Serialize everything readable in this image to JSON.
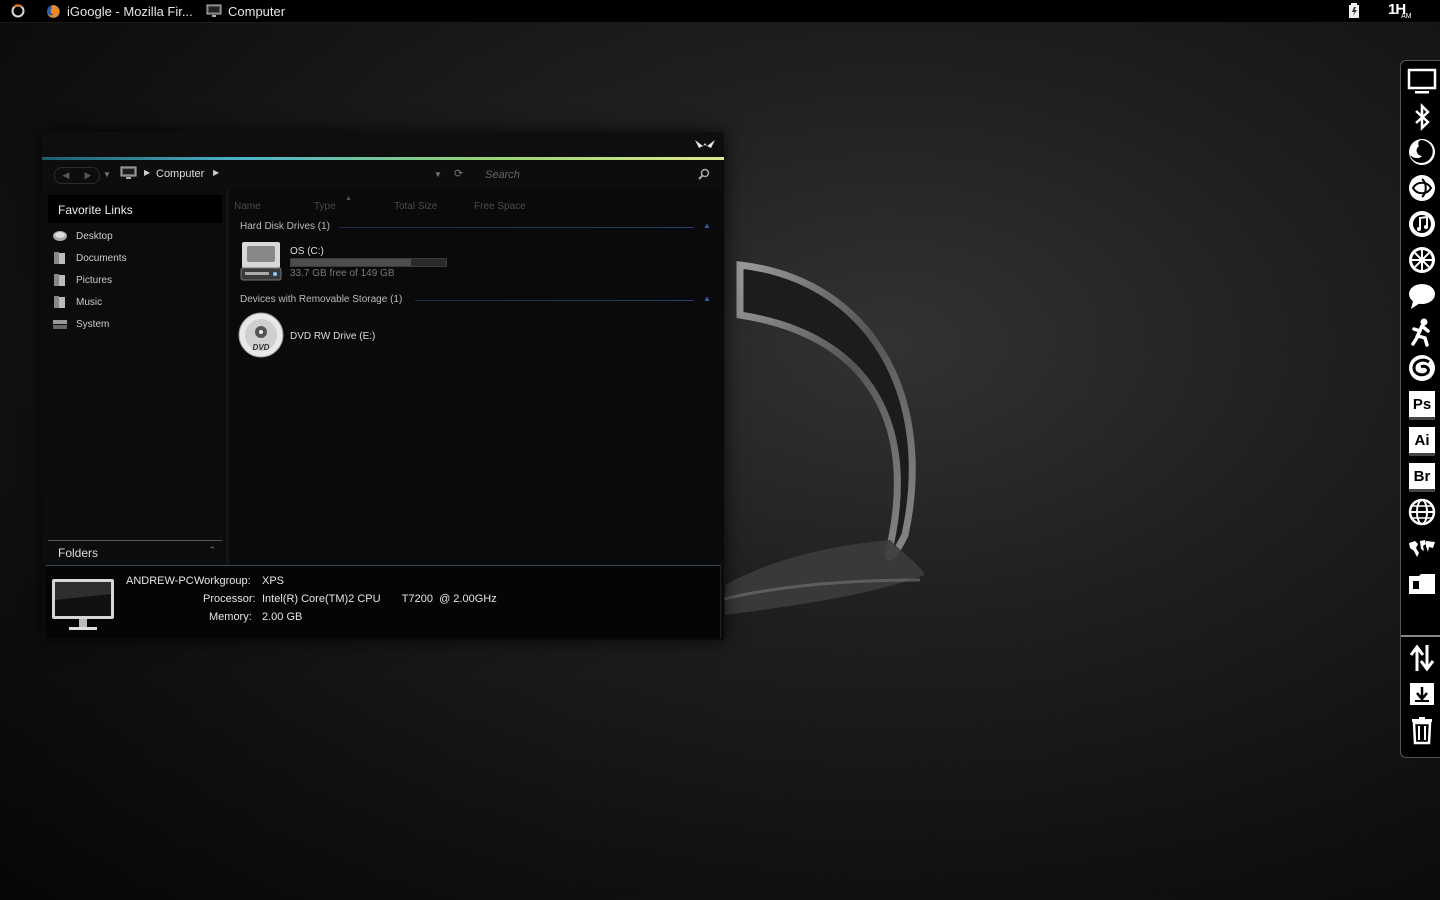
{
  "taskbar": {
    "tasks": [
      {
        "label": "iGoogle - Mozilla Fir...",
        "icon": "firefox-icon"
      },
      {
        "label": "Computer",
        "icon": "computer-icon"
      }
    ],
    "clock": {
      "hour": "1",
      "suffix": "AM",
      "glyph": "H"
    }
  },
  "window": {
    "breadcrumb": "Computer",
    "search_placeholder": "Search",
    "favorites_title": "Favorite Links",
    "favorites": [
      {
        "label": "Desktop",
        "icon": "desktop-icon"
      },
      {
        "label": "Documents",
        "icon": "documents-icon"
      },
      {
        "label": "Pictures",
        "icon": "pictures-icon"
      },
      {
        "label": "Music",
        "icon": "music-icon"
      },
      {
        "label": "System",
        "icon": "system-icon"
      }
    ],
    "folders_label": "Folders",
    "columns": [
      "Name",
      "Type",
      "Total Size",
      "Free Space"
    ],
    "groups": [
      {
        "title": "Hard Disk Drives (1)",
        "items": [
          {
            "name": "OS (C:)",
            "free_text": "33.7 GB free of 149 GB",
            "used_fraction": 0.774
          }
        ]
      },
      {
        "title": "Devices with Removable Storage (1)",
        "items": [
          {
            "name": "DVD RW Drive (E:)",
            "disc_label": "DVD"
          }
        ]
      }
    ],
    "details": {
      "computer_name": "ANDREW-PC",
      "workgroup_label": "Workgroup:",
      "workgroup": "XPS",
      "processor_label": "Processor:",
      "processor": "Intel(R) Core(TM)2 CPU       T7200  @ 2.00GHz",
      "memory_label": "Memory:",
      "memory": "2.00 GB"
    }
  },
  "dock": {
    "items": [
      {
        "name": "monitor-icon"
      },
      {
        "name": "bluetooth-icon"
      },
      {
        "name": "firefox-icon"
      },
      {
        "name": "globe-flower-icon"
      },
      {
        "name": "itunes-icon"
      },
      {
        "name": "aperture-icon"
      },
      {
        "name": "chat-bubble-icon"
      },
      {
        "name": "runner-icon"
      },
      {
        "name": "swirl-icon"
      },
      {
        "name": "photoshop-icon",
        "text": "Ps"
      },
      {
        "name": "illustrator-icon",
        "text": "Ai"
      },
      {
        "name": "bridge-icon",
        "text": "Br"
      },
      {
        "name": "internet-globe-icon"
      },
      {
        "name": "world-map-icon"
      },
      {
        "name": "document-icon"
      },
      {
        "name": "transfer-arrows-icon"
      },
      {
        "name": "download-icon"
      },
      {
        "name": "trash-icon"
      }
    ]
  },
  "colors": {
    "accent_gradient": [
      "#1b5e70",
      "#4fb4c9",
      "#97d476",
      "#dfe88a"
    ],
    "group_line": "#263e6b",
    "background": "#1f1f1f"
  }
}
